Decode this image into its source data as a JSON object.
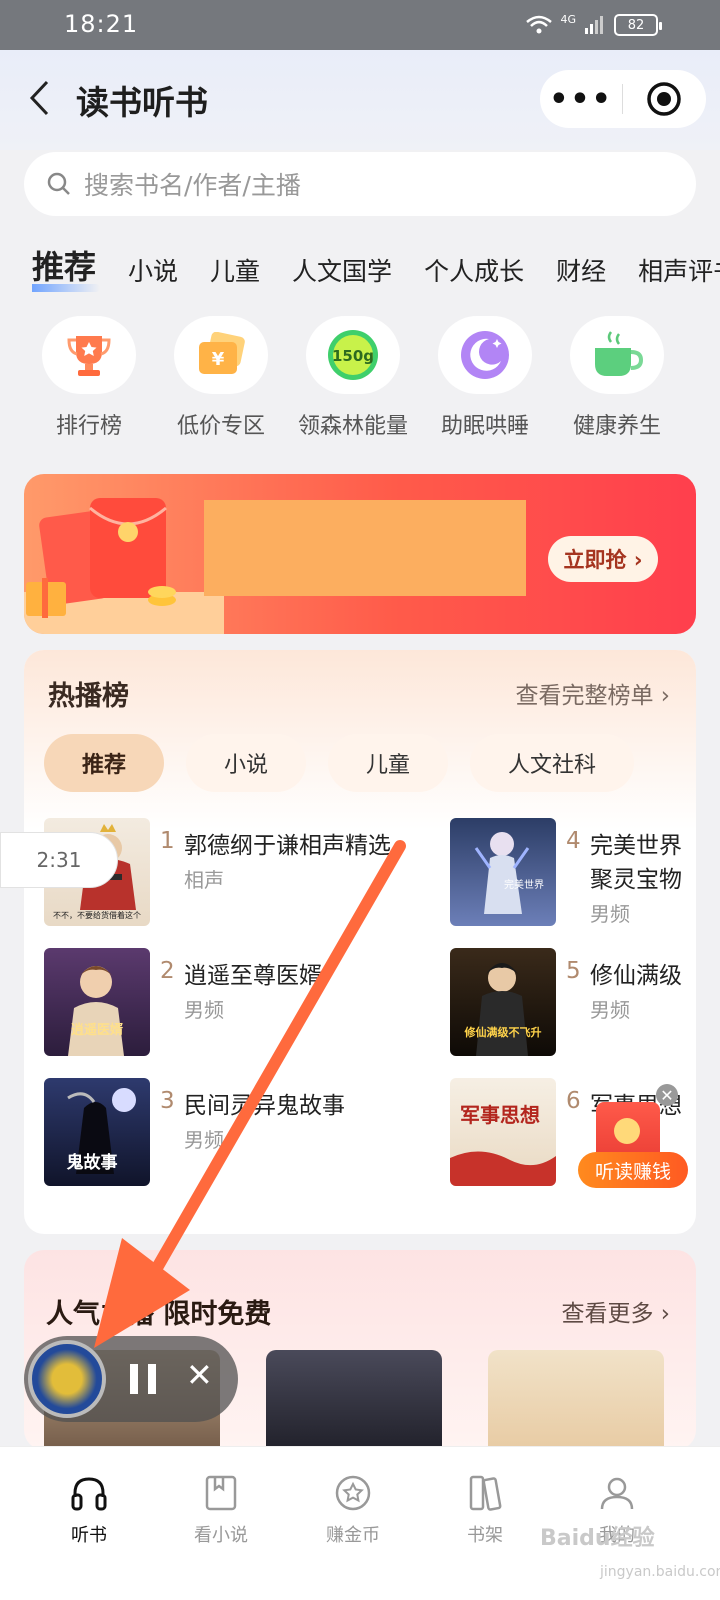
{
  "status_bar": {
    "time": "18:21",
    "network": "4G",
    "battery": "82"
  },
  "header": {
    "title": "读书听书",
    "more_label": "•••"
  },
  "search": {
    "placeholder": "搜索书名/作者/主播"
  },
  "category_tabs": [
    "推荐",
    "小说",
    "儿童",
    "人文国学",
    "个人成长",
    "财经",
    "相声评书"
  ],
  "quick_entries": [
    {
      "label": "排行榜",
      "icon": "trophy-icon"
    },
    {
      "label": "低价专区",
      "icon": "ticket-icon"
    },
    {
      "label": "领森林能量",
      "icon": "energy-150g-icon",
      "badge": "150g"
    },
    {
      "label": "助眠哄睡",
      "icon": "moon-icon"
    },
    {
      "label": "健康养生",
      "icon": "teacup-icon"
    }
  ],
  "banner": {
    "cta": "立即抢 ›"
  },
  "hot_chart": {
    "title": "热播榜",
    "more": "查看完整榜单 ›",
    "chips": [
      "推荐",
      "小说",
      "儿童",
      "人文社科"
    ],
    "items": [
      {
        "rank": "1",
        "name": "郭德纲于谦相声精选",
        "category": "相声",
        "cover_caption": "不不，不要给货借着这个"
      },
      {
        "rank": "2",
        "name": "逍遥至尊医婿",
        "category": "男频",
        "cover_caption": "逍遥医婿"
      },
      {
        "rank": "3",
        "name": "民间灵异鬼故事",
        "category": "男频",
        "cover_caption": "鬼故事"
      },
      {
        "rank": "4",
        "name": "完美世界",
        "name_line2": "聚灵宝物",
        "category": "男频",
        "cover_caption": "完美世界"
      },
      {
        "rank": "5",
        "name": "修仙满级",
        "category": "男频",
        "cover_caption": "修仙满级不飞升"
      },
      {
        "rank": "6",
        "name": "军事思想",
        "category": "",
        "cover_caption": "军事思想"
      }
    ]
  },
  "timer": "2:31",
  "earn_badge": "听读赚钱",
  "popular": {
    "title": "人气主播 限时免费",
    "more": "查看更多 ›"
  },
  "player": {
    "pause_label": "❚❚",
    "close_label": "✕"
  },
  "bottom_nav": [
    {
      "label": "听书",
      "icon": "headphones-icon",
      "active": true
    },
    {
      "label": "看小说",
      "icon": "book-icon"
    },
    {
      "label": "赚金币",
      "icon": "coin-star-icon"
    },
    {
      "label": "书架",
      "icon": "bookshelf-icon"
    },
    {
      "label": "我的",
      "icon": "person-icon"
    }
  ],
  "watermark": {
    "brand": "Baidu经验",
    "url": "jingyan.baidu.com"
  },
  "colors": {
    "accent_orange": "#ff6a3d",
    "banner_red": "#ff4a4a",
    "highlight_block": "#fcae5f"
  }
}
